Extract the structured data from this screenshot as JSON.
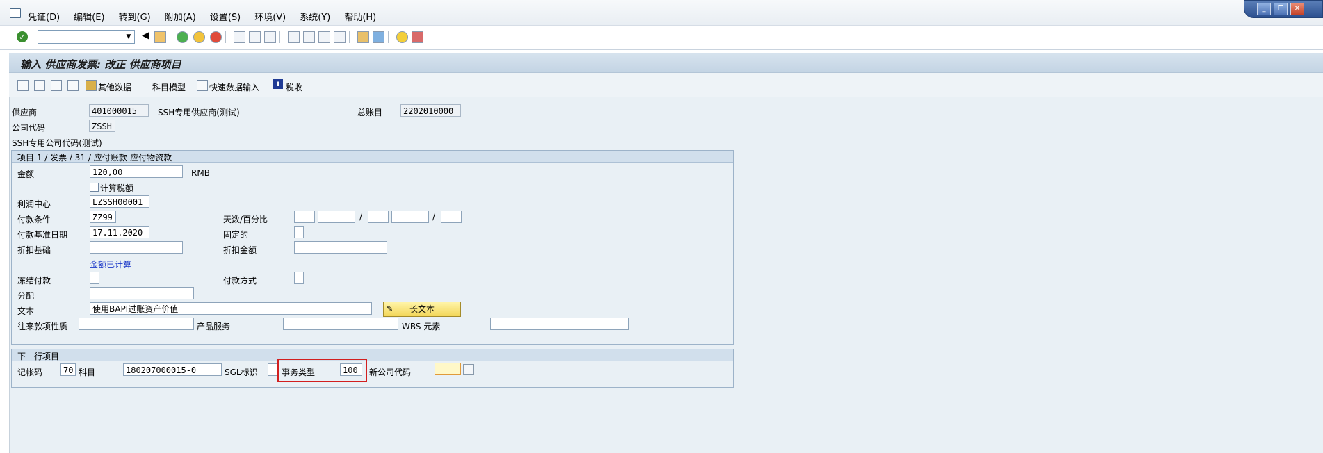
{
  "menu": [
    "凭证(D)",
    "编辑(E)",
    "转到(G)",
    "附加(A)",
    "设置(S)",
    "环境(V)",
    "系统(Y)",
    "帮助(H)"
  ],
  "title": "输入 供应商发票: 改正 供应商项目",
  "app_toolbar": {
    "other_data": "其他数据",
    "account_model": "科目模型",
    "fast_entry": "快速数据输入",
    "tax": "税收"
  },
  "header": {
    "vendor_label": "供应商",
    "vendor_value": "401000015",
    "vendor_name": "SSH专用供应商(测试)",
    "gl_label": "总账目",
    "gl_value": "2202010000",
    "company_label": "公司代码",
    "company_value": "ZSSH",
    "company_name": "SSH专用公司代码(测试)"
  },
  "item_group": {
    "title": "项目 1 / 发票 / 31 / 应付账款-应付物资款",
    "amount_label": "金额",
    "amount_value": "120,00",
    "currency": "RMB",
    "calc_tax_label": "计算税额",
    "profit_center_label": "利润中心",
    "profit_center_value": "LZSSH00001",
    "pay_terms_label": "付款条件",
    "pay_terms_value": "ZZ99",
    "days_pct_label": "天数/百分比",
    "baseline_label": "付款基准日期",
    "baseline_value": "17.11.2020",
    "fixed_label": "固定的",
    "disc_base_label": "折扣基础",
    "disc_amount_label": "折扣金额",
    "calculated_text": "金额已计算",
    "block_label": "冻结付款",
    "pay_method_label": "付款方式",
    "assignment_label": "分配",
    "text_label": "文本",
    "text_value": "使用BAPI过账资产价值",
    "long_text_button": "长文本",
    "trading_label": "往来款项性质",
    "product_label": "产品服务",
    "wbs_label": "WBS 元素"
  },
  "next_line": {
    "title": "下一行项目",
    "posting_key_label": "记帐码",
    "posting_key_value": "70",
    "account_label": "科目",
    "account_value": "180207000015-0",
    "sgl_label": "SGL标识",
    "trans_type_label": "事务类型",
    "trans_type_value": "100",
    "new_company_label": "新公司代码"
  }
}
